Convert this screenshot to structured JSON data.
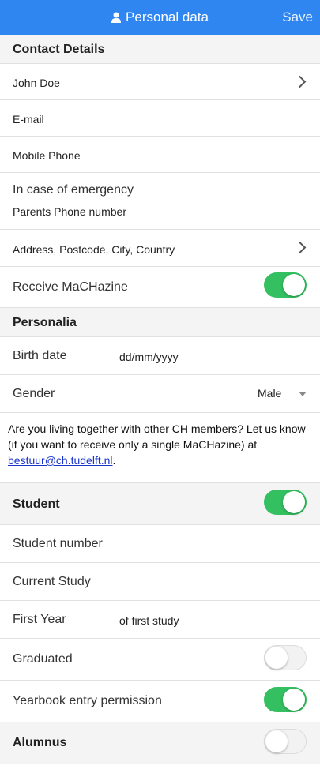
{
  "header": {
    "title": "Personal data",
    "save_label": "Save"
  },
  "contact": {
    "section_title": "Contact Details",
    "name": "John Doe",
    "email_placeholder": "E-mail",
    "mobile_placeholder": "Mobile Phone",
    "emergency_label": "In case of emergency",
    "emergency_placeholder": "Parents Phone number",
    "address_placeholder": "Address, Postcode, City, Country",
    "machazine_label": "Receive MaCHazine",
    "machazine_on": true
  },
  "personalia": {
    "section_title": "Personalia",
    "birth_label": "Birth date",
    "birth_value": "dd/mm/yyyy",
    "gender_label": "Gender",
    "gender_value": "Male"
  },
  "notice": {
    "text": "Are you living together with other CH members? Let us know (if you want to receive only a single MaCHazine) at",
    "email": "bestuur@ch.tudelft.nl",
    "suffix": "."
  },
  "student": {
    "section_title": "Student",
    "student_on": true,
    "number_label": "Student number",
    "study_label": "Current Study",
    "first_year_label": "First Year",
    "first_year_placeholder": "of first study",
    "graduated_label": "Graduated",
    "graduated_on": false,
    "yearbook_label": "Yearbook entry permission",
    "yearbook_on": true
  },
  "alumnus": {
    "section_title": "Alumnus",
    "alumnus_on": false
  },
  "colors": {
    "header_bg": "#2f86f0",
    "toggle_on": "#34c060",
    "link": "#1a33cc"
  }
}
